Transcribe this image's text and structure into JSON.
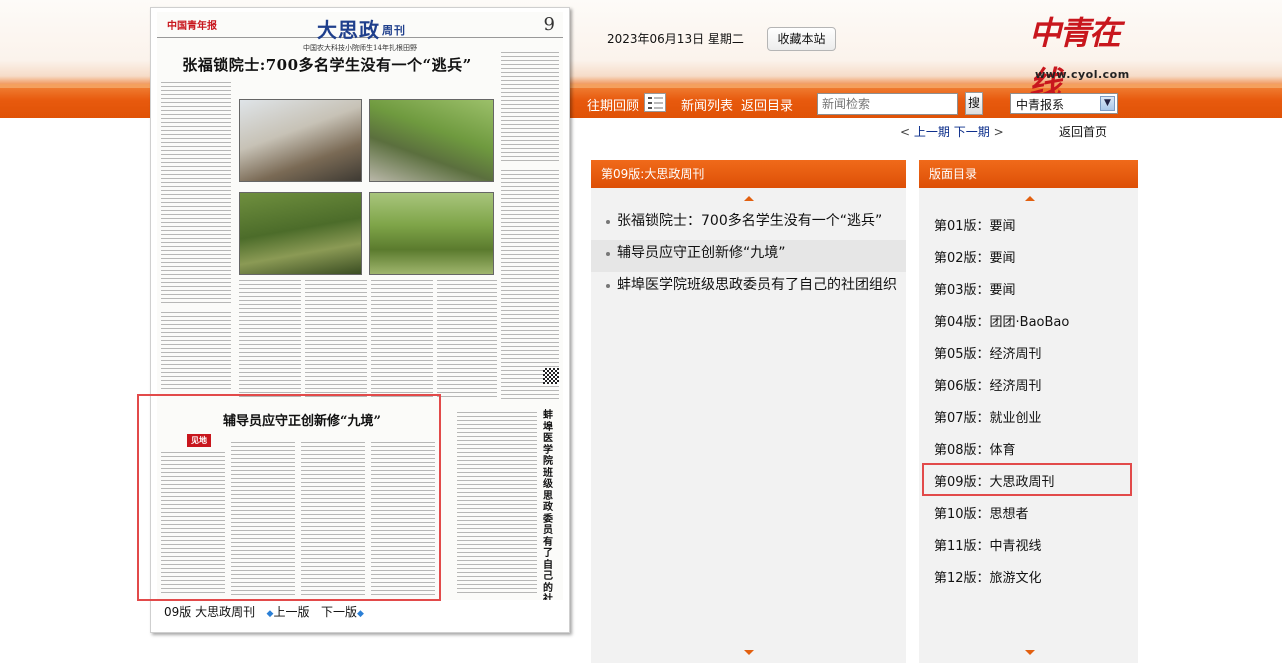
{
  "header": {
    "date": "2023年06月13日 星期二",
    "favorite_button": "收藏本站",
    "logo_text": "中青在线",
    "logo_url_text": "www.cyol.com"
  },
  "nav": {
    "past_review": "往期回顾",
    "news_list": "新闻列表",
    "back_to_index": "返回目录",
    "search_placeholder": "新闻检索",
    "search_button": "搜",
    "newspaper_select": "中青报系",
    "prev_page": "上一期",
    "next_page": "下一期",
    "home": "返回首页",
    "pager_left": "<",
    "pager_right": ">"
  },
  "newspaper": {
    "brand": "中国青年报",
    "section_title": "大思政",
    "section_sub": "周刊",
    "page_number": "9",
    "kicker": "中国农大科技小院师生14年扎根田野",
    "headline": "张福锁院士:700多名学生没有一个“逃兵”",
    "box_headline": "辅导员应守正创新修“九境”",
    "box_tag": "见地",
    "vertical_headline": "蚌埠医学院班级思政委员有了自己的社团组织",
    "footer_label": "09版 大思政周刊",
    "footer_prev": "上一版",
    "footer_next": "下一版"
  },
  "news_panel": {
    "title": "第09版:大思政周刊",
    "items": [
      "张福锁院士：700多名学生没有一个“逃兵”",
      "辅导员应守正创新修“九境”",
      "蚌埠医学院班级思政委员有了自己的社团组织"
    ]
  },
  "directory": {
    "title": "版面目录",
    "items": [
      "第01版：要闻",
      "第02版：要闻",
      "第03版：要闻",
      "第04版：团团·BaoBao",
      "第05版：经济周刊",
      "第06版：经济周刊",
      "第07版：就业创业",
      "第08版：体育",
      "第09版：大思政周刊",
      "第10版：思想者",
      "第11版：中青视线",
      "第12版：旅游文化"
    ]
  }
}
